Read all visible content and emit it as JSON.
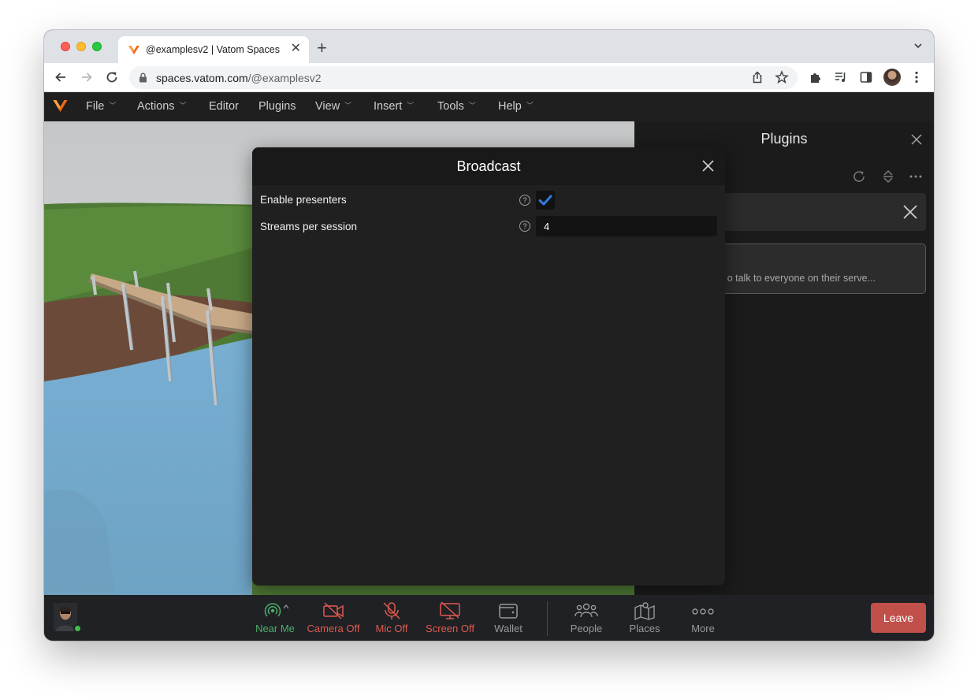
{
  "browser": {
    "tab_title": "@examplesv2 | Vatom Spaces",
    "url_host": "spaces.vatom.com",
    "url_path": "/@examplesv2"
  },
  "app_menu": {
    "items": [
      {
        "label": "File",
        "has_dropdown": true
      },
      {
        "label": "Actions",
        "has_dropdown": true
      },
      {
        "label": "Editor",
        "has_dropdown": false
      },
      {
        "label": "Plugins",
        "has_dropdown": false
      },
      {
        "label": "View",
        "has_dropdown": true
      },
      {
        "label": "Insert",
        "has_dropdown": true
      },
      {
        "label": "Tools",
        "has_dropdown": true
      },
      {
        "label": "Help",
        "has_dropdown": true
      }
    ]
  },
  "plugins_panel": {
    "title": "Plugins",
    "plugin_description": "o talk to everyone on their serve..."
  },
  "modal": {
    "title": "Broadcast",
    "settings": [
      {
        "label": "Enable presenters",
        "type": "checkbox",
        "checked": true
      },
      {
        "label": "Streams per session",
        "type": "number",
        "value": "4"
      }
    ]
  },
  "bottom_bar": {
    "buttons": [
      {
        "label": "Near Me",
        "icon": "near-me-icon",
        "color": "#4caf6a"
      },
      {
        "label": "Camera Off",
        "icon": "camera-off-icon",
        "color": "#e05a50"
      },
      {
        "label": "Mic Off",
        "icon": "mic-off-icon",
        "color": "#e05a50"
      },
      {
        "label": "Screen Off",
        "icon": "screen-off-icon",
        "color": "#e05a50"
      },
      {
        "label": "Wallet",
        "icon": "wallet-icon",
        "color": "#9a9a9a"
      },
      {
        "label": "People",
        "icon": "people-icon",
        "color": "#9a9a9a"
      },
      {
        "label": "Places",
        "icon": "map-icon",
        "color": "#9a9a9a"
      },
      {
        "label": "More",
        "icon": "more-dots-icon",
        "color": "#9a9a9a"
      }
    ],
    "leave_label": "Leave"
  },
  "colors": {
    "accent_check": "#2f7de1",
    "leave": "#c2504a",
    "status_off": "#e05a50",
    "status_on": "#4caf6a"
  }
}
